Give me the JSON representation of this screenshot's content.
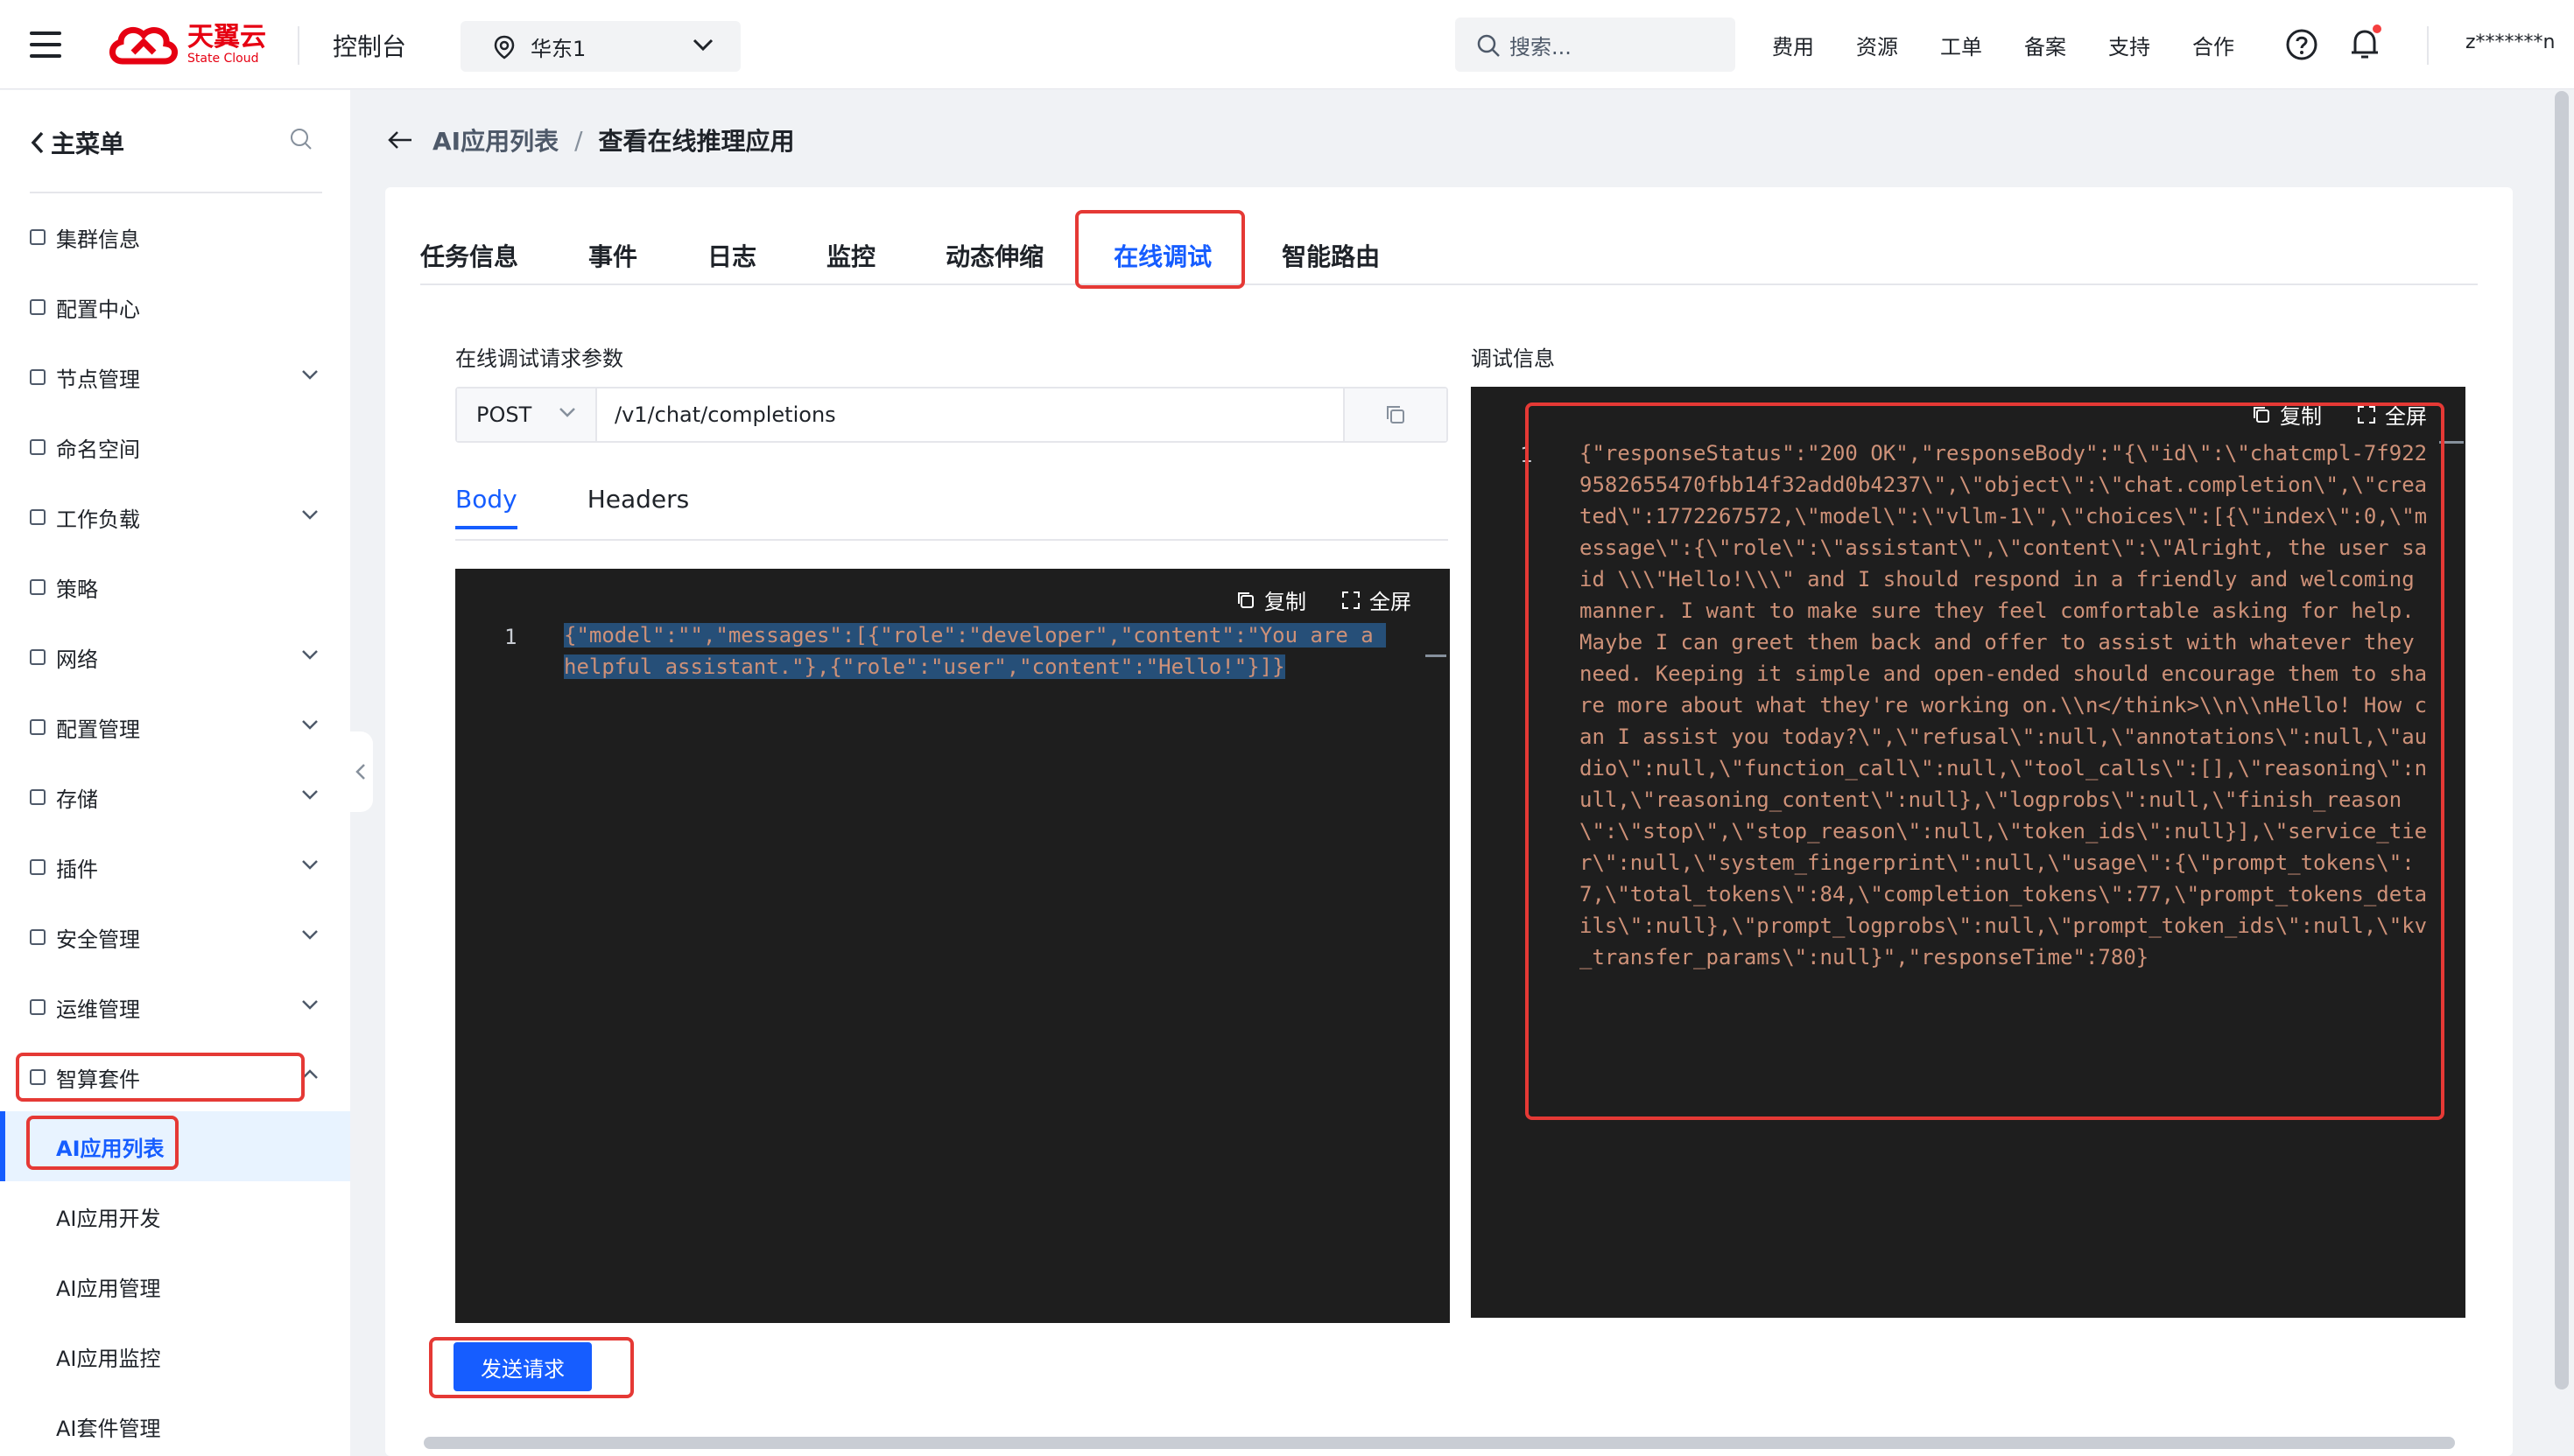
{
  "topbar": {
    "brand_cn": "天翼云",
    "brand_en": "State Cloud",
    "console": "控制台",
    "region": "华东1",
    "search_placeholder": "搜索...",
    "links": [
      "费用",
      "资源",
      "工单",
      "备案",
      "支持",
      "合作"
    ],
    "user": "z*******n"
  },
  "sidebar": {
    "title": "主菜单",
    "items": [
      {
        "label": "集群信息",
        "expandable": false
      },
      {
        "label": "配置中心",
        "expandable": false
      },
      {
        "label": "节点管理",
        "expandable": true
      },
      {
        "label": "命名空间",
        "expandable": false
      },
      {
        "label": "工作负载",
        "expandable": true
      },
      {
        "label": "策略",
        "expandable": false
      },
      {
        "label": "网络",
        "expandable": true
      },
      {
        "label": "配置管理",
        "expandable": true
      },
      {
        "label": "存储",
        "expandable": true
      },
      {
        "label": "插件",
        "expandable": true
      },
      {
        "label": "安全管理",
        "expandable": true
      },
      {
        "label": "运维管理",
        "expandable": true
      },
      {
        "label": "智算套件",
        "expandable": true
      }
    ],
    "subitems": [
      "AI应用列表",
      "AI应用开发",
      "AI应用管理",
      "AI应用监控",
      "AI套件管理"
    ]
  },
  "breadcrumb": {
    "parent": "AI应用列表",
    "current": "查看在线推理应用"
  },
  "tabs": [
    "任务信息",
    "事件",
    "日志",
    "监控",
    "动态伸缩",
    "在线调试",
    "智能路由"
  ],
  "active_tab": "在线调试",
  "request": {
    "section_label": "在线调试请求参数",
    "method": "POST",
    "url": "/v1/chat/completions",
    "subtabs": [
      "Body",
      "Headers"
    ],
    "active_subtab": "Body",
    "body_line": "1",
    "body_code": "{\"model\":\"\",\"messages\":[{\"role\":\"developer\",\"content\":\"You are a helpful assistant.\"},{\"role\":\"user\",\"content\":\"Hello!\"}]}",
    "send_label": "发送请求"
  },
  "debug": {
    "section_label": "调试信息",
    "line": "1",
    "output": "{\"responseStatus\":\"200 OK\",\"responseBody\":\"{\\\"id\\\":\\\"chatcmpl-7f9229582655470fbb14f32add0b4237\\\",\\\"object\\\":\\\"chat.completion\\\",\\\"created\\\":1772267572,\\\"model\\\":\\\"vllm-1\\\",\\\"choices\\\":[{\\\"index\\\":0,\\\"message\\\":{\\\"role\\\":\\\"assistant\\\",\\\"content\\\":\\\"Alright, the user said \\\\\\\"Hello!\\\\\\\" and I should respond in a friendly and welcoming manner. I want to make sure they feel comfortable asking for help. Maybe I can greet them back and offer to assist with whatever they need. Keeping it simple and open-ended should encourage them to share more about what they're working on.\\\\n</think>\\\\n\\\\nHello! How can I assist you today?\\\",\\\"refusal\\\":null,\\\"annotations\\\":null,\\\"audio\\\":null,\\\"function_call\\\":null,\\\"tool_calls\\\":[],\\\"reasoning\\\":null,\\\"reasoning_content\\\":null},\\\"logprobs\\\":null,\\\"finish_reason\\\":\\\"stop\\\",\\\"stop_reason\\\":null,\\\"token_ids\\\":null}],\\\"service_tier\\\":null,\\\"system_fingerprint\\\":null,\\\"usage\\\":{\\\"prompt_tokens\\\":7,\\\"total_tokens\\\":84,\\\"completion_tokens\\\":77,\\\"prompt_tokens_details\\\":null},\\\"prompt_logprobs\\\":null,\\\"prompt_token_ids\\\":null,\\\"kv_transfer_params\\\":null}\",\"responseTime\":780}"
  },
  "editor_tools": {
    "copy": "复制",
    "fullscreen": "全屏"
  },
  "colors": {
    "accent": "#165dff",
    "highlight": "#e53935",
    "code_string": "#ce9178",
    "code_brace": "#ffd700",
    "editor_bg": "#1e1e1e",
    "selection": "#264f78"
  }
}
